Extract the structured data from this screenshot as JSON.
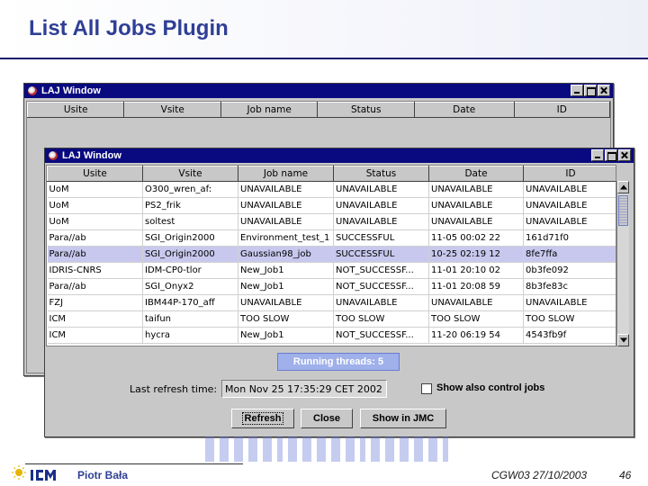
{
  "slide": {
    "title": "List All Jobs Plugin",
    "footer_author": "Piotr Bała",
    "footer_conference": "CGW03 27/10/2003",
    "page_number": "46"
  },
  "back_window": {
    "title": "LAJ Window",
    "columns": [
      "Usite",
      "Vsite",
      "Job name",
      "Status",
      "Date",
      "ID"
    ]
  },
  "front_window": {
    "title": "LAJ Window",
    "columns": [
      "Usite",
      "Vsite",
      "Job name",
      "Status",
      "Date",
      "ID"
    ],
    "rows": [
      [
        "UoM",
        "O300_wren_af:",
        "UNAVAILABLE",
        "UNAVAILABLE",
        "UNAVAILABLE",
        "UNAVAILABLE"
      ],
      [
        "UoM",
        "PS2_frik",
        "UNAVAILABLE",
        "UNAVAILABLE",
        "UNAVAILABLE",
        "UNAVAILABLE"
      ],
      [
        "UoM",
        "soltest",
        "UNAVAILABLE",
        "UNAVAILABLE",
        "UNAVAILABLE",
        "UNAVAILABLE"
      ],
      [
        "Para//ab",
        "SGI_Origin2000",
        "Environment_test_1",
        "SUCCESSFUL",
        "11-05 00:02 22",
        "161d71f0"
      ],
      [
        "Para//ab",
        "SGI_Origin2000",
        "Gaussian98_job",
        "SUCCESSFUL",
        "10-25 02:19 12",
        "8fe7ffa"
      ],
      [
        "IDRIS-CNRS",
        "IDM-CP0-tlor",
        "New_Job1",
        "NOT_SUCCESSF...",
        "11-01 20:10 02",
        "0b3fe092"
      ],
      [
        "Para//ab",
        "SGI_Onyx2",
        "New_Job1",
        "NOT_SUCCESSF...",
        "11-01 20:08 59",
        "8b3fe83c"
      ],
      [
        "FZJ",
        "IBM44P-170_aff",
        "UNAVAILABLE",
        "UNAVAILABLE",
        "UNAVAILABLE",
        "UNAVAILABLE"
      ],
      [
        "ICM",
        "taifun",
        "TOO SLOW",
        "TOO SLOW",
        "TOO SLOW",
        "TOO SLOW"
      ],
      [
        "ICM",
        "hycra",
        "New_Job1",
        "NOT_SUCCESSF...",
        "11-20 06:19 54",
        "4543fb9f"
      ]
    ],
    "selected_row": 4,
    "running_threads": "Running threads: 5",
    "last_refresh_label": "Last refresh time:",
    "last_refresh_value": "Mon Nov 25 17:35:29 CET 2002",
    "show_control_jobs_label": "Show also control jobs",
    "buttons": {
      "refresh": "Refresh",
      "close": "Close",
      "show_in_jmc": "Show in JMC"
    }
  },
  "colors": {
    "titlebar": "#0a0a80",
    "window_bg": "#c8c8c8",
    "selected_row": "#c8c8ee",
    "slide_title": "#2f3f95",
    "threads_bar": "#9fb0ea"
  }
}
